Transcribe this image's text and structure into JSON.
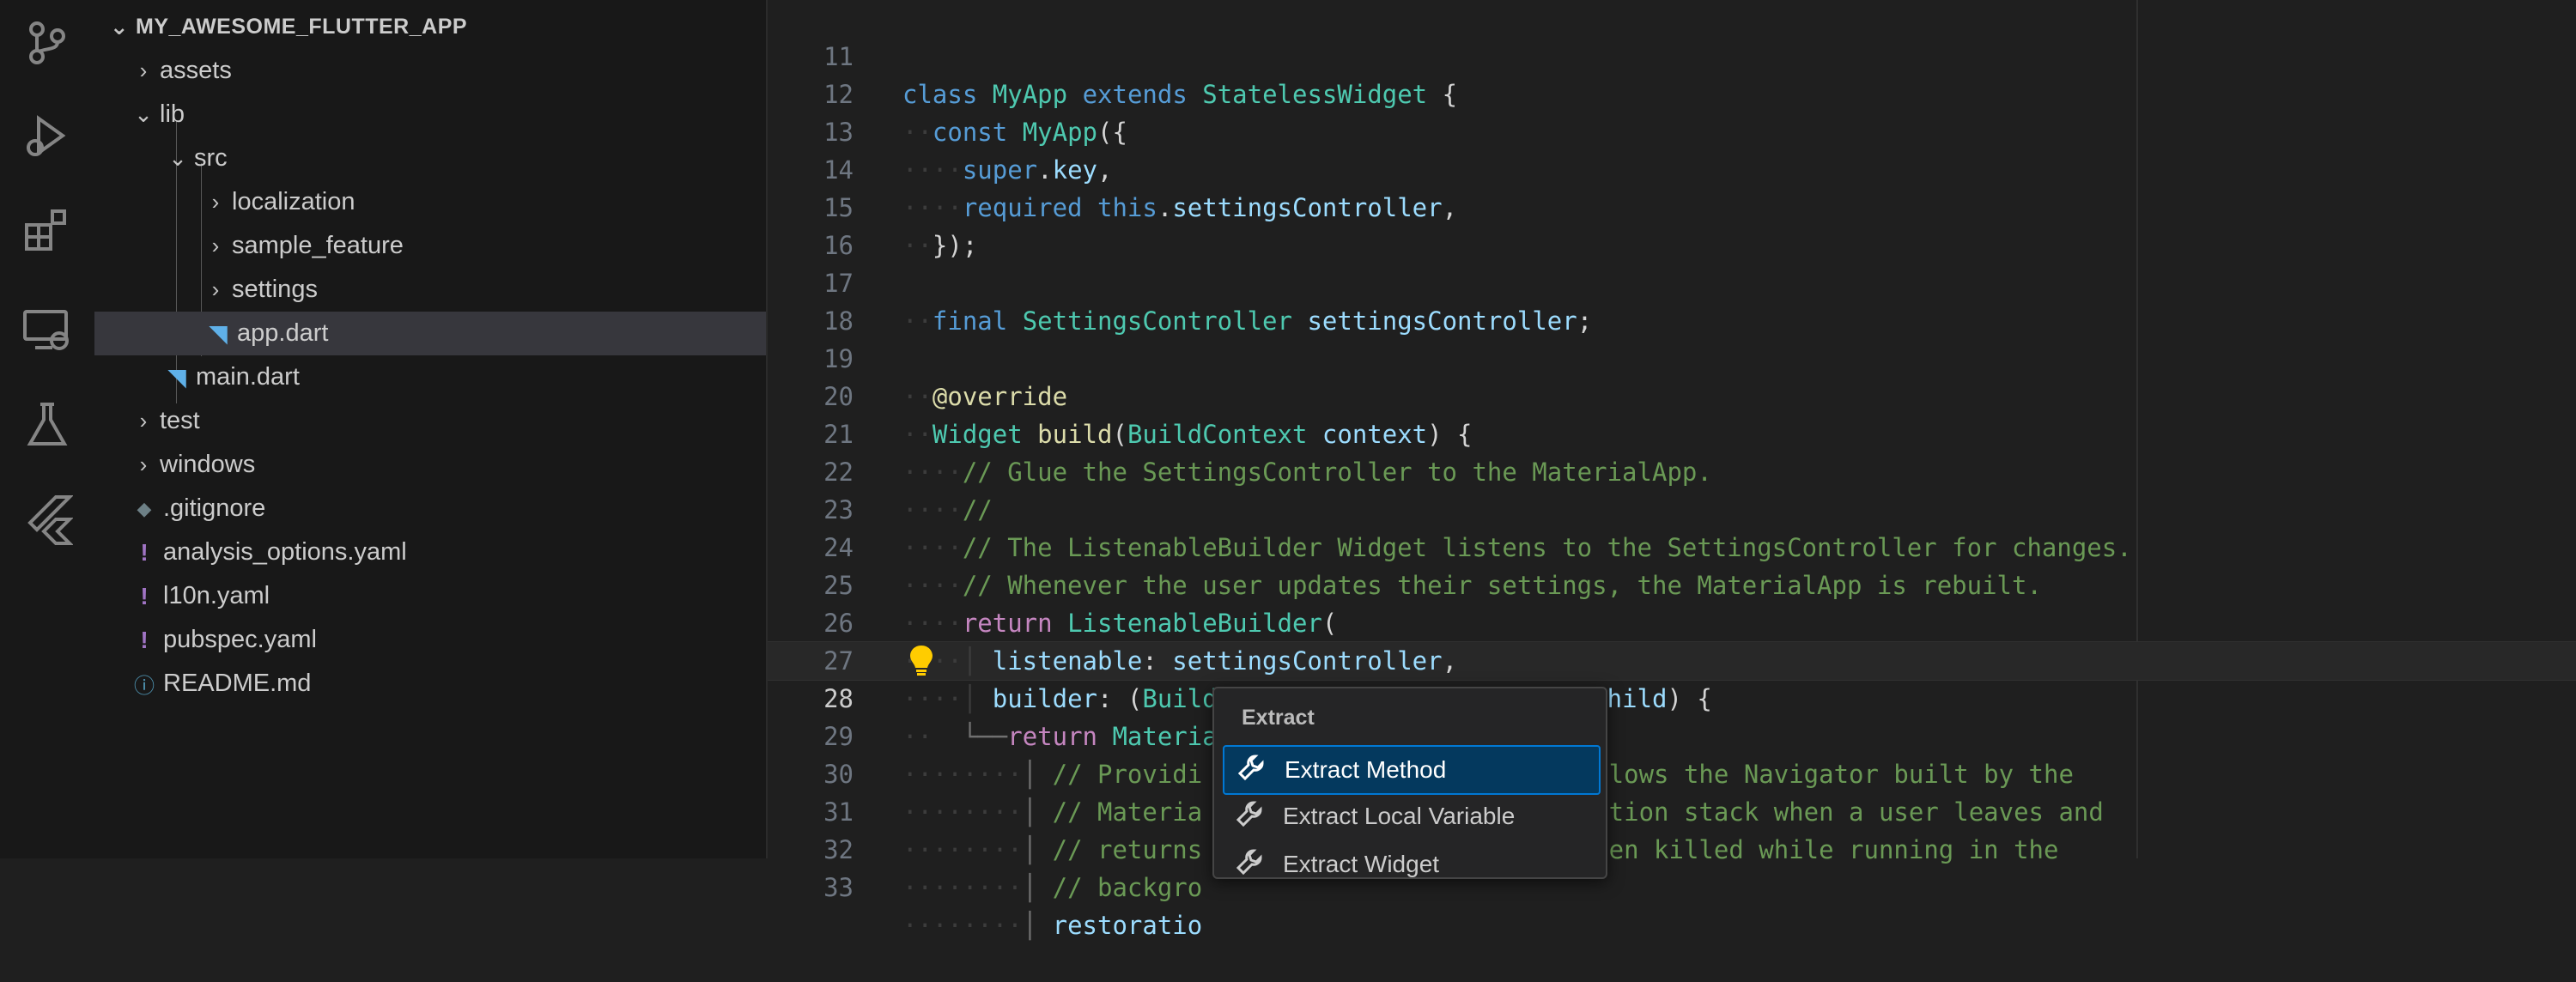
{
  "activity_bar": {
    "icons": [
      "source-control-icon",
      "run-debug-icon",
      "extensions-icon",
      "remote-explorer-icon",
      "testing-icon",
      "flutter-icon"
    ]
  },
  "explorer": {
    "root": "MY_AWESOME_FLUTTER_APP",
    "items": [
      {
        "label": "assets",
        "type": "folder",
        "expanded": false
      },
      {
        "label": "lib",
        "type": "folder",
        "expanded": true
      },
      {
        "label": "src",
        "type": "folder",
        "expanded": true
      },
      {
        "label": "localization",
        "type": "folder",
        "expanded": false
      },
      {
        "label": "sample_feature",
        "type": "folder",
        "expanded": false
      },
      {
        "label": "settings",
        "type": "folder",
        "expanded": false
      },
      {
        "label": "app.dart",
        "type": "dart",
        "selected": true
      },
      {
        "label": "main.dart",
        "type": "dart"
      },
      {
        "label": "test",
        "type": "folder",
        "expanded": false
      },
      {
        "label": "windows",
        "type": "folder",
        "expanded": false
      },
      {
        "label": ".gitignore",
        "type": "gitignore"
      },
      {
        "label": "analysis_options.yaml",
        "type": "yaml"
      },
      {
        "label": "l10n.yaml",
        "type": "yaml"
      },
      {
        "label": "pubspec.yaml",
        "type": "yaml"
      },
      {
        "label": "README.md",
        "type": "info"
      }
    ]
  },
  "editor": {
    "active_line": 28,
    "lines": [
      {
        "n": "11",
        "text": "class MyApp extends StatelessWidget {"
      },
      {
        "n": "12",
        "text": "const MyApp({"
      },
      {
        "n": "13",
        "text": "super.key,"
      },
      {
        "n": "14",
        "text": "required this.settingsController,"
      },
      {
        "n": "15",
        "text": "});"
      },
      {
        "n": "16",
        "text": ""
      },
      {
        "n": "17",
        "text": "final SettingsController settingsController;"
      },
      {
        "n": "18",
        "text": ""
      },
      {
        "n": "19",
        "text": "@override"
      },
      {
        "n": "20",
        "text": "Widget build(BuildContext context) {"
      },
      {
        "n": "21",
        "text": "// Glue the SettingsController to the MaterialApp."
      },
      {
        "n": "22",
        "text": "//"
      },
      {
        "n": "23",
        "text": "// The ListenableBuilder Widget listens to the SettingsController for changes."
      },
      {
        "n": "24",
        "text": "// Whenever the user updates their settings, the MaterialApp is rebuilt."
      },
      {
        "n": "25",
        "text": "return ListenableBuilder("
      },
      {
        "n": "26",
        "text": "listenable: settingsController,"
      },
      {
        "n": "27",
        "text": "builder: (BuildContext context, Widget? child) {"
      },
      {
        "n": "28",
        "text": "return MaterialApp("
      },
      {
        "n": "29",
        "text": "// Providi"
      },
      {
        "n": "30",
        "text": "// Materia"
      },
      {
        "n": "31",
        "text": "// returns"
      },
      {
        "n": "32",
        "text": "// backgro"
      },
      {
        "n": "33",
        "text": "restoratio"
      }
    ],
    "line_tails": {
      "29": "llows the Navigator built by the",
      "30": "ation stack when a user leaves and",
      "31": "een killed while running in the"
    }
  },
  "context_menu": {
    "header": "Extract",
    "items": [
      {
        "label": "Extract Method",
        "active": true
      },
      {
        "label": "Extract Local Variable",
        "active": false
      },
      {
        "label": "Extract Widget",
        "active": false
      }
    ]
  },
  "colors": {
    "background": "#1f1f1f",
    "sidebar": "#181818",
    "selection": "#37373d",
    "menu_highlight": "#04395e",
    "accent": "#0078d4"
  }
}
